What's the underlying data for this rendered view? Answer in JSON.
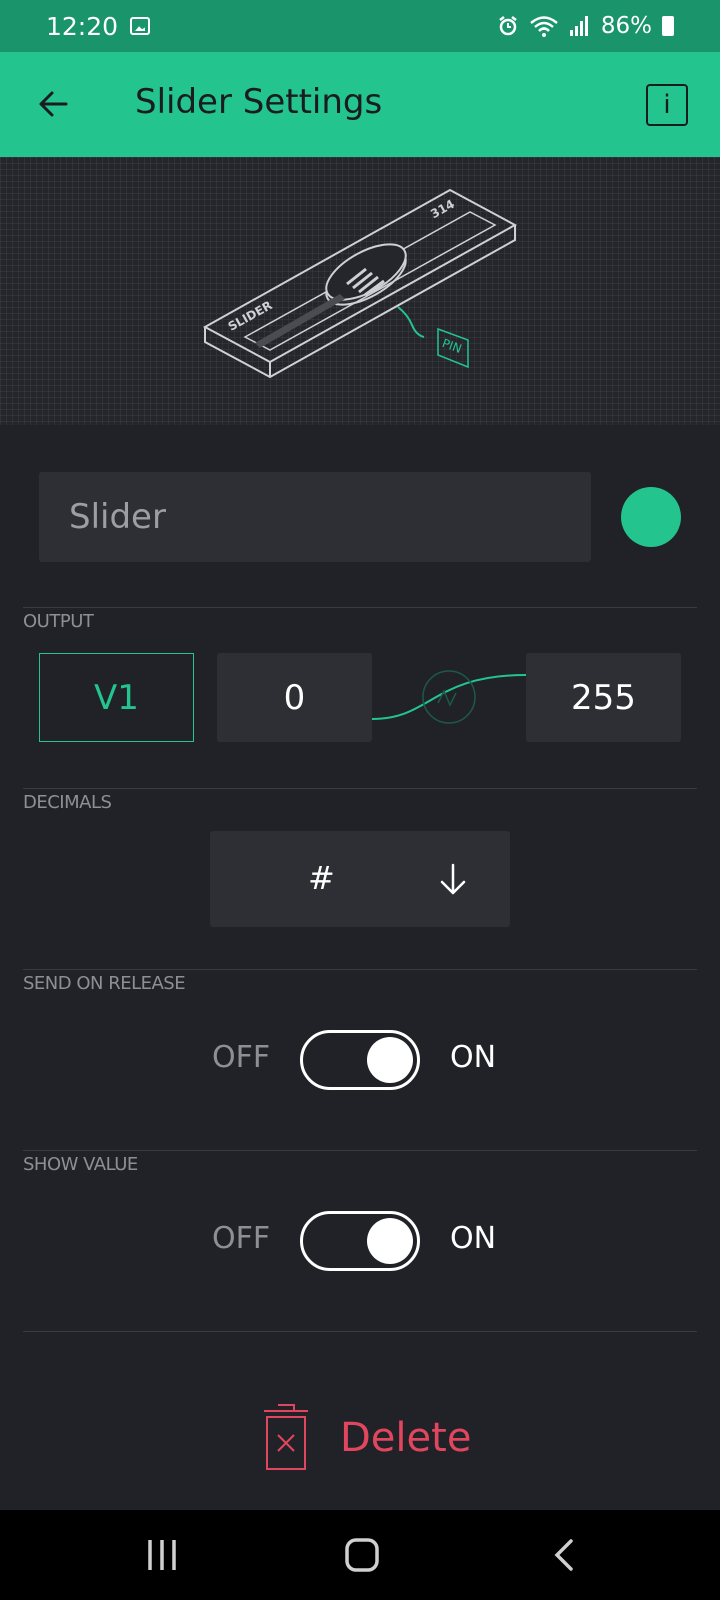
{
  "status_bar": {
    "time": "12:20",
    "battery": "86%"
  },
  "app_bar": {
    "title": "Slider Settings",
    "info_label": "i"
  },
  "hero": {
    "slider_label": "SLIDER",
    "pin_label": "PIN",
    "number_label": "314"
  },
  "name_field": {
    "placeholder": "Slider",
    "value": ""
  },
  "colors": {
    "accent": "#23c48e",
    "danger": "#e0465e",
    "background": "#212227",
    "field": "#2e2f35"
  },
  "output": {
    "label": "OUTPUT",
    "pin": "V1",
    "min": "0",
    "max": "255"
  },
  "decimals": {
    "label": "DECIMALS",
    "value": "#"
  },
  "send_on_release": {
    "label": "SEND ON RELEASE",
    "off": "OFF",
    "on": "ON",
    "state": true
  },
  "show_value": {
    "label": "SHOW VALUE",
    "off": "OFF",
    "on": "ON",
    "state": true
  },
  "delete": {
    "label": "Delete"
  }
}
